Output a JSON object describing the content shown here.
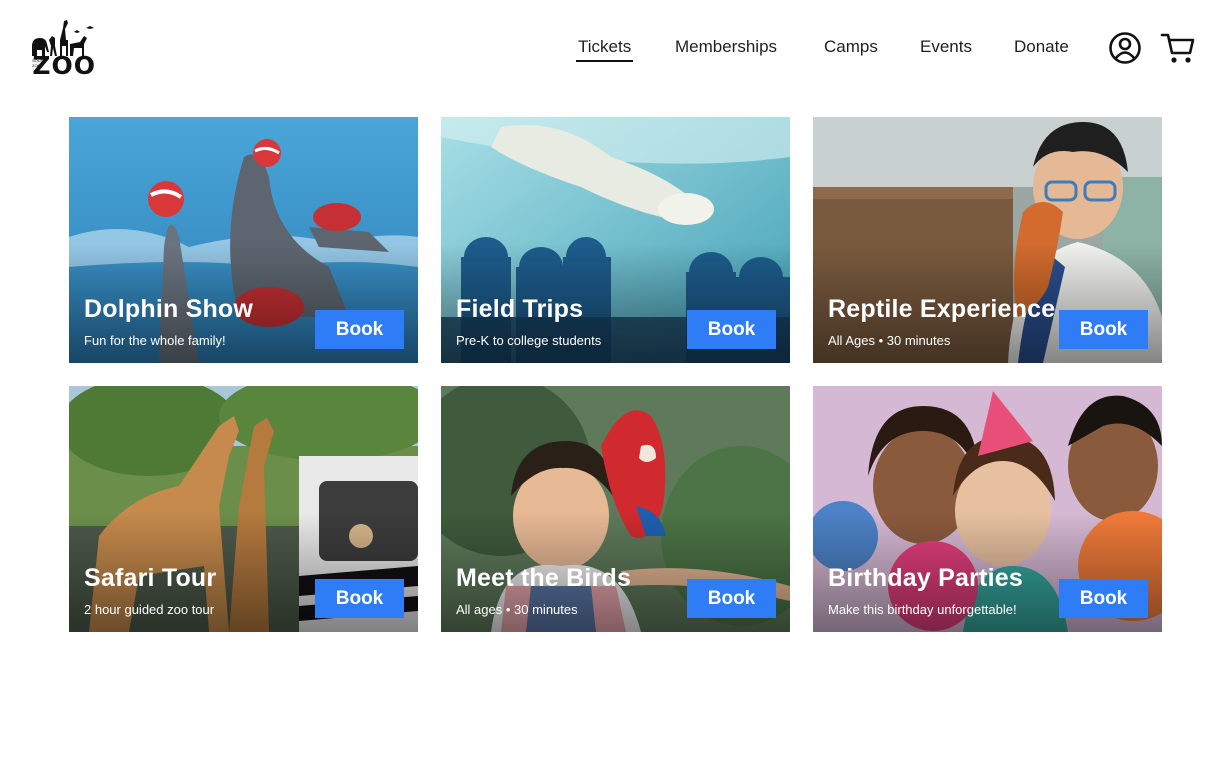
{
  "brand": {
    "logo_text": "ZOO",
    "logo_sub": "SOUTH ZOO"
  },
  "nav": {
    "items": [
      {
        "label": "Tickets",
        "active": true
      },
      {
        "label": "Memberships",
        "active": false
      },
      {
        "label": "Camps",
        "active": false
      },
      {
        "label": "Events",
        "active": false
      },
      {
        "label": "Donate",
        "active": false
      }
    ],
    "account_icon": "account-circle-icon",
    "cart_icon": "shopping-cart-icon"
  },
  "cards": [
    {
      "title": "Dolphin Show",
      "subtitle": "Fun for the whole family!",
      "button": "Book"
    },
    {
      "title": "Field Trips",
      "subtitle": "Pre-K to college students",
      "button": "Book"
    },
    {
      "title": "Reptile Experience",
      "subtitle": "All Ages • 30 minutes",
      "button": "Book"
    },
    {
      "title": "Safari Tour",
      "subtitle": "2 hour guided zoo tour",
      "button": "Book"
    },
    {
      "title": "Meet the Birds",
      "subtitle": "All ages • 30 minutes",
      "button": "Book"
    },
    {
      "title": "Birthday Parties",
      "subtitle": "Make this birthday unforgettable!",
      "button": "Book"
    }
  ],
  "colors": {
    "accent": "#2f7df6",
    "text": "#1f1f1f"
  }
}
